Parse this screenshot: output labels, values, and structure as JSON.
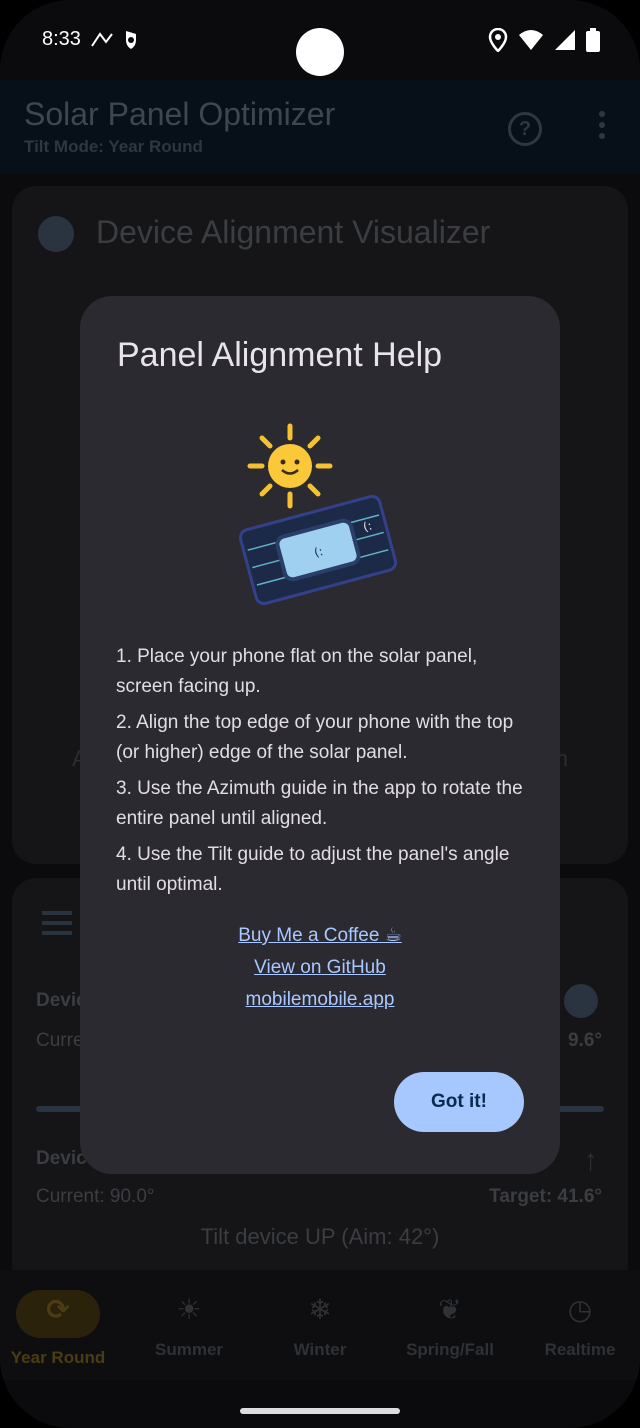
{
  "status": {
    "time": "8:33"
  },
  "app": {
    "title": "Solar Panel Optimizer",
    "subtitle": "Tilt Mode: Year Round"
  },
  "background_card": {
    "title": "Device Alignment Visualizer",
    "left_fragment": "A",
    "right_fragment": "n"
  },
  "background_card2": {
    "device_label_1": "Devic",
    "current_1": "Curre",
    "value_1": "9.6°",
    "device_label_2": "Devic",
    "current_2": "Current: 90.0°",
    "target_2": "Target: 41.6°",
    "instruction": "Tilt device UP (Aim: 42°)"
  },
  "dialog": {
    "title": "Panel Alignment Help",
    "steps": [
      "1. Place your phone flat on the solar panel, screen facing up.",
      "2. Align the top edge of your phone with the top (or higher) edge of the solar panel.",
      "3. Use the Azimuth guide in the app to rotate the entire panel until aligned.",
      "4. Use the Tilt guide to adjust the panel's angle until optimal."
    ],
    "links": {
      "coffee": "Buy Me a Coffee ☕",
      "github": "View on GitHub",
      "site": "mobilemobile.app"
    },
    "confirm_label": "Got it!"
  },
  "nav": [
    {
      "label": "Year Round",
      "icon": "sync-icon"
    },
    {
      "label": "Summer",
      "icon": "sun-icon"
    },
    {
      "label": "Winter",
      "icon": "snowflake-icon"
    },
    {
      "label": "Spring/Fall",
      "icon": "leaf-icon"
    },
    {
      "label": "Realtime",
      "icon": "clock-icon"
    }
  ],
  "colors": {
    "dialog_bg": "#2b2a30",
    "link": "#a8c8ff",
    "button_bg": "#a6c8ff",
    "active_nav": "#4b3d12"
  }
}
